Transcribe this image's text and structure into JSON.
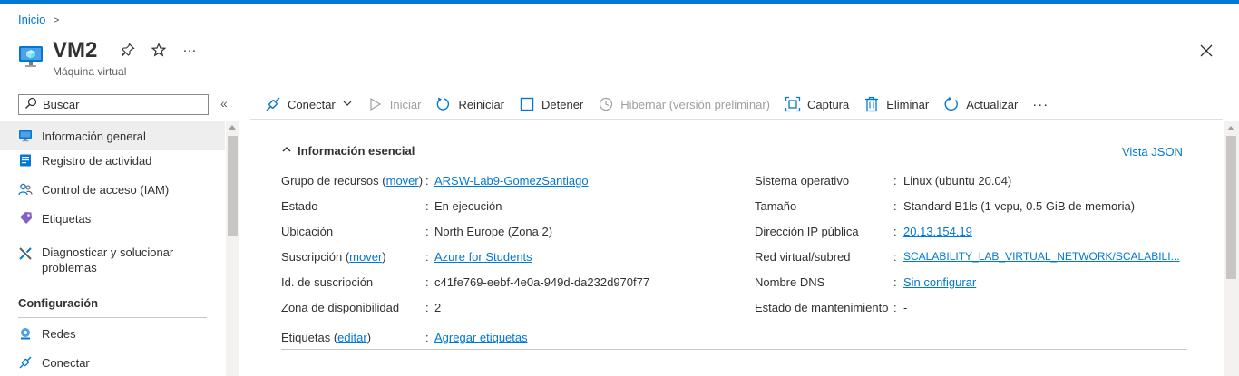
{
  "breadcrumb": {
    "home": "Inicio",
    "separator": ">"
  },
  "header": {
    "title": "VM2",
    "subtitle": "Máquina virtual",
    "more": "···"
  },
  "search": {
    "placeholder": "Buscar",
    "collapse": "«"
  },
  "sidebar": {
    "items": [
      {
        "label": "Información general",
        "icon": "monitor-icon",
        "active": true
      },
      {
        "label": "Registro de actividad",
        "icon": "log-icon"
      },
      {
        "label": "Control de acceso (IAM)",
        "icon": "people-icon"
      },
      {
        "label": "Etiquetas",
        "icon": "tag-icon"
      },
      {
        "label": "Diagnosticar y solucionar problemas",
        "icon": "wrench-icon"
      }
    ],
    "section": "Configuración",
    "config_items": [
      {
        "label": "Redes",
        "icon": "network-icon"
      },
      {
        "label": "Conectar",
        "icon": "connect-icon"
      }
    ]
  },
  "toolbar": {
    "connect": "Conectar",
    "start": "Iniciar",
    "restart": "Reiniciar",
    "stop": "Detener",
    "hibernate": "Hibernar (versión preliminar)",
    "capture": "Captura",
    "delete": "Eliminar",
    "refresh": "Actualizar",
    "more": "···"
  },
  "essentials": {
    "heading": "Información esencial",
    "json_view": "Vista JSON",
    "left": [
      {
        "label": "Grupo de recursos",
        "label_link": "mover",
        "value": "ARSW-Lab9-GomezSantiago",
        "value_is_link": true
      },
      {
        "label": "Estado",
        "value": "En ejecución"
      },
      {
        "label": "Ubicación",
        "value": "North Europe (Zona 2)"
      },
      {
        "label": "Suscripción",
        "label_link": "mover",
        "value": "Azure for Students",
        "value_is_link": true
      },
      {
        "label": "Id. de suscripción",
        "value": "c41fe769-eebf-4e0a-949d-da232d970f77"
      },
      {
        "label": "Zona de disponibilidad",
        "value": "2"
      }
    ],
    "right": [
      {
        "label": "Sistema operativo",
        "value": "Linux (ubuntu 20.04)"
      },
      {
        "label": "Tamaño",
        "value": "Standard B1ls (1 vcpu, 0.5 GiB de memoria)"
      },
      {
        "label": "Dirección IP pública",
        "value": "20.13.154.19",
        "value_is_link": true
      },
      {
        "label": "Red virtual/subred",
        "value": "SCALABILITY_LAB_VIRTUAL_NETWORK/SCALABILI...",
        "value_is_link": true
      },
      {
        "label": "Nombre DNS",
        "value": "Sin configurar",
        "value_is_link": true
      },
      {
        "label": "Estado de mantenimiento",
        "value": "-"
      }
    ],
    "tags": {
      "label": "Etiquetas",
      "label_link": "editar",
      "value": "Agregar etiquetas"
    },
    "colon": ":"
  },
  "colors": {
    "accent": "#0078d4",
    "text": "#323130",
    "muted": "#605e5c",
    "disabled": "#a19f9d"
  }
}
